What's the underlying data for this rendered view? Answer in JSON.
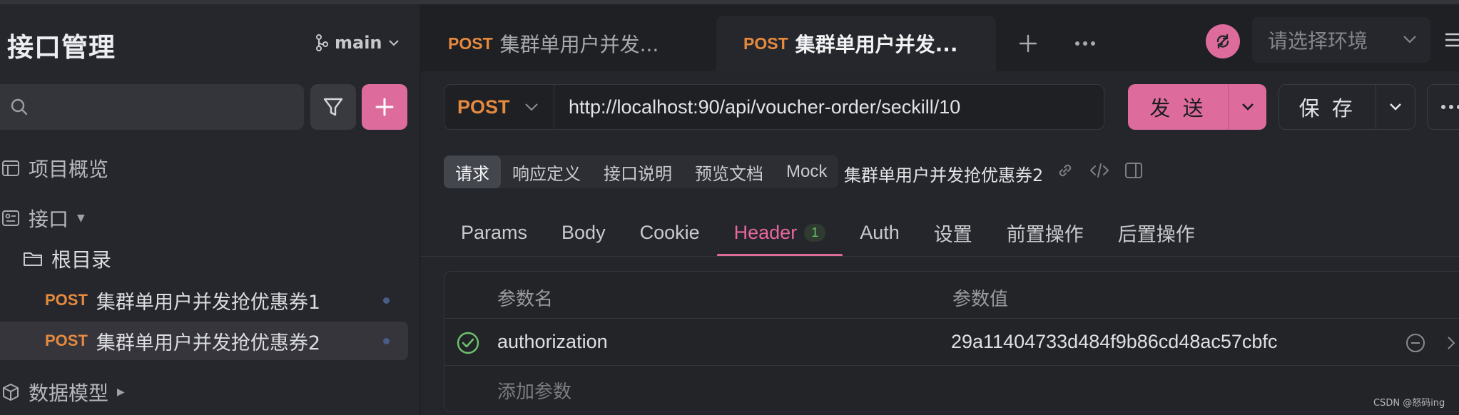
{
  "sidebar": {
    "title": "接口管理",
    "branch": "main",
    "search_placeholder": "",
    "nav": {
      "overview": "项目概览",
      "apis": "接口",
      "data_models": "数据模型"
    },
    "folder": "根目录",
    "items": [
      {
        "method": "POST",
        "name": "集群单用户并发抢优惠券1",
        "selected": false
      },
      {
        "method": "POST",
        "name": "集群单用户并发抢优惠券2",
        "selected": true
      }
    ]
  },
  "tabs": [
    {
      "method": "POST",
      "title": "集群单用户并发...",
      "active": false
    },
    {
      "method": "POST",
      "title": "集群单用户并发...",
      "active": true
    }
  ],
  "env": {
    "placeholder": "请选择环境"
  },
  "request": {
    "method": "POST",
    "url": "http://localhost:90/api/voucher-order/seckill/10",
    "send_label": "发 送",
    "save_label": "保 存"
  },
  "segments": [
    "请求",
    "响应定义",
    "接口说明",
    "预览文档",
    "Mock"
  ],
  "doc_name": "集群单用户并发抢优惠券2",
  "subtabs": [
    {
      "label": "Params"
    },
    {
      "label": "Body"
    },
    {
      "label": "Cookie"
    },
    {
      "label": "Header",
      "badge": "1",
      "active": true
    },
    {
      "label": "Auth"
    },
    {
      "label": "设置"
    },
    {
      "label": "前置操作"
    },
    {
      "label": "后置操作"
    }
  ],
  "table": {
    "col_name": "参数名",
    "col_value": "参数值",
    "rows": [
      {
        "enabled": true,
        "name": "authorization",
        "value": "29a11404733d484f9b86cd48ac57cbfc"
      }
    ],
    "add_label": "添加参数"
  },
  "watermark": "CSDN @怒码ing",
  "colors": {
    "accent": "#dd6c9d",
    "method_post": "#e58a3e",
    "badge_green": "#6cc26d"
  }
}
